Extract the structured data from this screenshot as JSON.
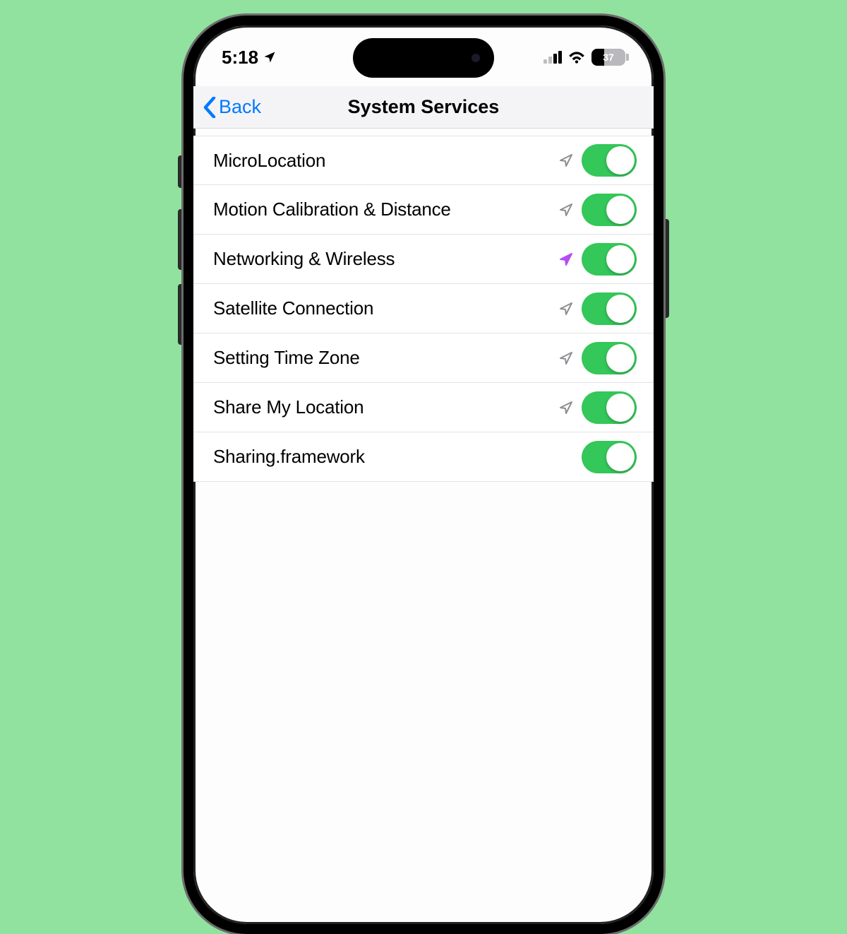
{
  "status": {
    "time": "5:18",
    "battery_percent": "37"
  },
  "nav": {
    "back_label": "Back",
    "title": "System Services"
  },
  "rows": [
    {
      "label": "MicroLocation",
      "icon": "gray",
      "on": true
    },
    {
      "label": "Motion Calibration & Distance",
      "icon": "gray",
      "on": true
    },
    {
      "label": "Networking & Wireless",
      "icon": "purple",
      "on": true
    },
    {
      "label": "Satellite Connection",
      "icon": "gray",
      "on": true
    },
    {
      "label": "Setting Time Zone",
      "icon": "gray",
      "on": true
    },
    {
      "label": "Share My Location",
      "icon": "gray",
      "on": true
    },
    {
      "label": "Sharing.framework",
      "icon": "none",
      "on": true
    }
  ],
  "colors": {
    "accent_blue": "#007aff",
    "toggle_green": "#34c759",
    "location_purple": "#b44ef2",
    "location_gray": "#8e8e93"
  }
}
